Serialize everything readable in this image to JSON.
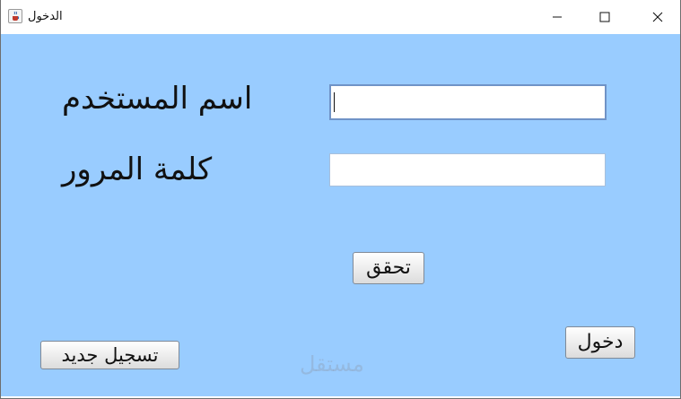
{
  "window": {
    "title": "الدخول",
    "icon": "java-cup-icon",
    "controls": [
      "minimize-icon",
      "maximize-icon",
      "close-icon"
    ]
  },
  "form": {
    "username_label": "اسم المستخدم",
    "username_value": "",
    "password_label": "كلمة المرور",
    "password_value": ""
  },
  "buttons": {
    "verify": "تحقق",
    "login": "دخول",
    "register": "تسجيل جديد"
  },
  "watermark": "مستقل",
  "colors": {
    "background": "#99ccff",
    "titlebar": "#ffffff"
  }
}
